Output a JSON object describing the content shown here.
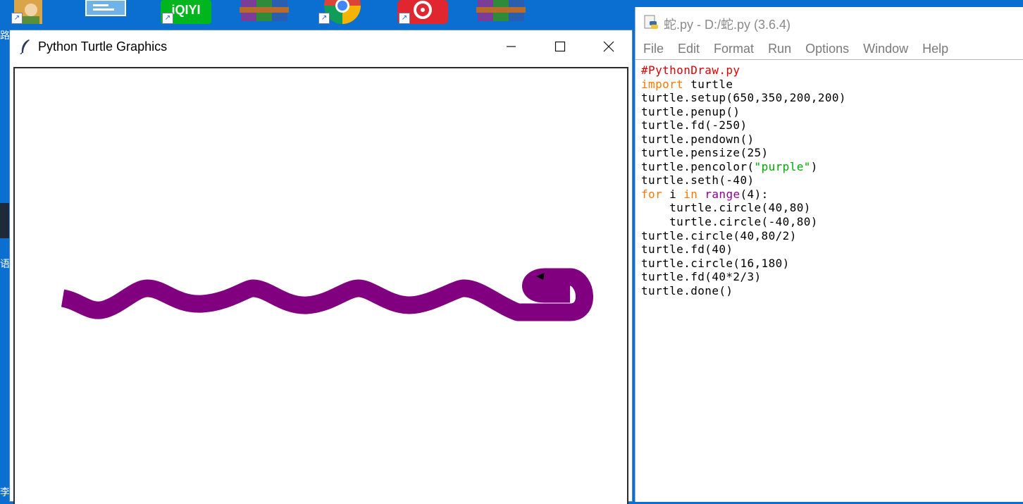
{
  "desktop": {
    "icons": [
      "user-icon",
      "control-panel-icon",
      "iqiyi-icon",
      "winrar-icon",
      "chrome-icon",
      "netease-music-icon",
      "winrar-icon"
    ],
    "edge_fragments": [
      "路",
      "语",
      "李"
    ],
    "background_color": "#0a6fd0"
  },
  "turtle_window": {
    "title": "Python Turtle Graphics",
    "pen_color": "#800080",
    "pen_size": 25
  },
  "idle_window": {
    "title": "蛇.py - D:/蛇.py (3.6.4)",
    "menu": [
      "File",
      "Edit",
      "Format",
      "Run",
      "Options",
      "Window",
      "Help"
    ],
    "code_lines": [
      [
        {
          "t": "#PythonDraw.py",
          "c": "comment"
        }
      ],
      [
        {
          "t": "import",
          "c": "keyword"
        },
        {
          "t": " turtle",
          "c": "plain"
        }
      ],
      [
        {
          "t": "turtle.setup(650,350,200,200)",
          "c": "plain"
        }
      ],
      [
        {
          "t": "turtle.penup()",
          "c": "plain"
        }
      ],
      [
        {
          "t": "turtle.fd(-250)",
          "c": "plain"
        }
      ],
      [
        {
          "t": "turtle.pendown()",
          "c": "plain"
        }
      ],
      [
        {
          "t": "turtle.pensize(25)",
          "c": "plain"
        }
      ],
      [
        {
          "t": "turtle.pencolor(",
          "c": "plain"
        },
        {
          "t": "\"purple\"",
          "c": "string"
        },
        {
          "t": ")",
          "c": "plain"
        }
      ],
      [
        {
          "t": "turtle.seth(-40)",
          "c": "plain"
        }
      ],
      [
        {
          "t": "for",
          "c": "keyword"
        },
        {
          "t": " i ",
          "c": "plain"
        },
        {
          "t": "in",
          "c": "keyword"
        },
        {
          "t": " ",
          "c": "plain"
        },
        {
          "t": "range",
          "c": "builtin"
        },
        {
          "t": "(4):",
          "c": "plain"
        }
      ],
      [
        {
          "t": "    turtle.circle(40,80)",
          "c": "plain"
        }
      ],
      [
        {
          "t": "    turtle.circle(-40,80)",
          "c": "plain"
        }
      ],
      [
        {
          "t": "turtle.circle(40,80/2)",
          "c": "plain"
        }
      ],
      [
        {
          "t": "turtle.fd(40)",
          "c": "plain"
        }
      ],
      [
        {
          "t": "turtle.circle(16,180)",
          "c": "plain"
        }
      ],
      [
        {
          "t": "turtle.fd(40*2/3)",
          "c": "plain"
        }
      ],
      [
        {
          "t": "turtle.done()",
          "c": "plain"
        }
      ]
    ]
  }
}
